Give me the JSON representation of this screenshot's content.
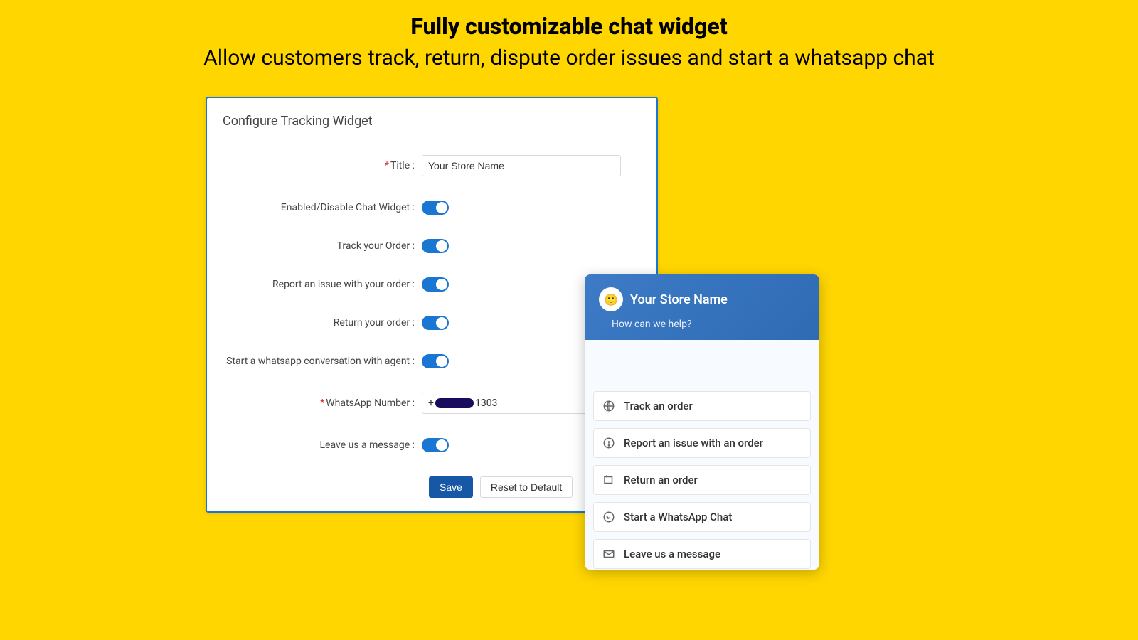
{
  "headline": "Fully customizable chat widget",
  "subline": "Allow customers track, return, dispute order issues and start a whatsapp chat",
  "panel": {
    "title": "Configure Tracking Widget",
    "fields": {
      "title_label": "Title :",
      "title_value": "Your Store Name",
      "enable_label": "Enabled/Disable Chat Widget :",
      "track_label": "Track your Order :",
      "report_label": "Report an issue with your order :",
      "return_label": "Return your order :",
      "whatsapp_label": "Start a whatsapp conversation with agent :",
      "wa_number_label": "WhatsApp Number :",
      "wa_number_prefix": "+",
      "wa_number_suffix": "1303",
      "leave_msg_label": "Leave us a message :"
    },
    "buttons": {
      "save": "Save",
      "reset": "Reset to Default"
    }
  },
  "chat": {
    "store_name": "Your Store Name",
    "help": "How can we help?",
    "options": {
      "track": "Track an order",
      "report": "Report an issue with an order",
      "ret": "Return an order",
      "wa": "Start a WhatsApp Chat",
      "msg": "Leave us a message"
    }
  }
}
